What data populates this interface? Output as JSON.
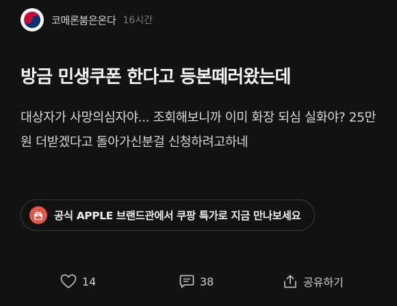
{
  "author": {
    "name": "코메론붐은온다",
    "time": "16시간",
    "avatar_icon": "taegeuk-icon"
  },
  "post": {
    "title": "방금 민생쿠폰 한다고 등본떼러왔는데",
    "body": "대상자가 사망의심자야... 조회해보니까 이미 화장 되심 실화야? 25만원 더받겠다고 돌아가신분걸 신청하려고하네"
  },
  "promo": {
    "text": "공식 APPLE 브랜드관에서 쿠팡 특가로 지금 만나보세요",
    "icon": "gift-icon",
    "icon_color": "#e2574c"
  },
  "actions": {
    "like_count": "14",
    "comment_count": "38",
    "share_label": "공유하기"
  },
  "colors": {
    "background": "#121212",
    "text_primary": "#f5f5f5",
    "text_secondary": "#7b7b7b"
  }
}
